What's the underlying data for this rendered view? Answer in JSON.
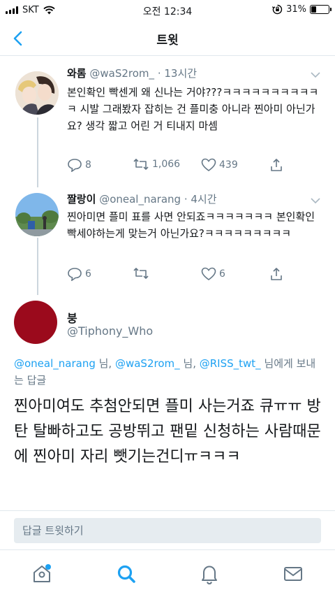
{
  "status_bar": {
    "carrier": "SKT",
    "time": "오전 12:34",
    "battery_text": "31%",
    "battery_level": 0.31
  },
  "nav": {
    "title": "트윗",
    "back_icon": "chevron-left-icon"
  },
  "tweets": [
    {
      "name": "와롬",
      "handle": "@waS2rom_",
      "time": "13시간",
      "text": "본인확인 빡센게 왜 신나는 거야???ㅋㅋㅋㅋㅋㅋㅋㅋㅋㅋㅋ 시발 그래봤자 잡히는 건 플미충 아니라 찐아미 아닌가요? 생각 짧고 어린 거 티내지 마셈",
      "replies": "8",
      "retweets": "1,066",
      "likes": "439"
    },
    {
      "name": "짤랑이",
      "handle": "@oneal_narang",
      "time": "4시간",
      "text": "찐아미면 플미 표를 사면 안되죠ㅋㅋㅋㅋㅋㅋㅋ 본인확인 빡세야하는게 맞는거 아닌가요?ㅋㅋㅋㅋㅋㅋㅋㅋㅋ",
      "replies": "6",
      "retweets": "",
      "likes": "6"
    }
  ],
  "main_tweet": {
    "name": "붕",
    "handle": "@Tiphony_Who",
    "reply_to": {
      "mention1": "@oneal_narang",
      "sep1": " 님, ",
      "mention2": "@waS2rom_",
      "sep2": " 님, ",
      "mention3": "@RISS_twt_",
      "suffix": " 님에게 보내는 답글"
    },
    "text": "찐아미여도 추첨안되면 플미 사는거죠 큐ㅠㅠ 방탄 탈빠하고도 공방뛰고 팬밑 신청하는 사람때문에 찐아미 자리 뺏기는건디ㅠㅋㅋㅋ"
  },
  "reply_bar": {
    "placeholder": "답글 트윗하기"
  },
  "tabbar": {
    "items": [
      "home-icon",
      "search-icon",
      "notifications-icon",
      "messages-icon"
    ]
  },
  "colors": {
    "accent": "#1da1f2",
    "secondary_text": "#657786",
    "divider": "#e1e8ed",
    "main_avatar": "#9b0a1c"
  }
}
